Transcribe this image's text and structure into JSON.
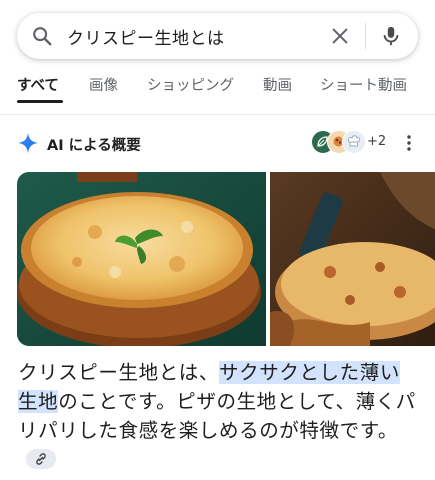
{
  "search": {
    "query": "クリスピー生地とは"
  },
  "tabs": [
    {
      "label": "すべて",
      "active": true
    },
    {
      "label": "画像"
    },
    {
      "label": "ショッピング"
    },
    {
      "label": "動画"
    },
    {
      "label": "ショート動画"
    }
  ],
  "ai_overview": {
    "title": "AI による概要",
    "sources_more": "+2",
    "images": [
      "margherita-pizza-on-wooden-board",
      "crispy-thin-pizza-with-cheese-pull"
    ],
    "answer": {
      "part1": "クリスピー生地とは、",
      "highlight": "サクサクとした薄い生地",
      "part2": "のことです。ピザの生地として、薄くパリパリした食感を楽しめるのが特徴です。"
    }
  },
  "colors": {
    "accent_blue": "#1a73e8",
    "highlight": "#d3e3fd",
    "text": "#1f1f1f",
    "muted": "#5f6368"
  }
}
